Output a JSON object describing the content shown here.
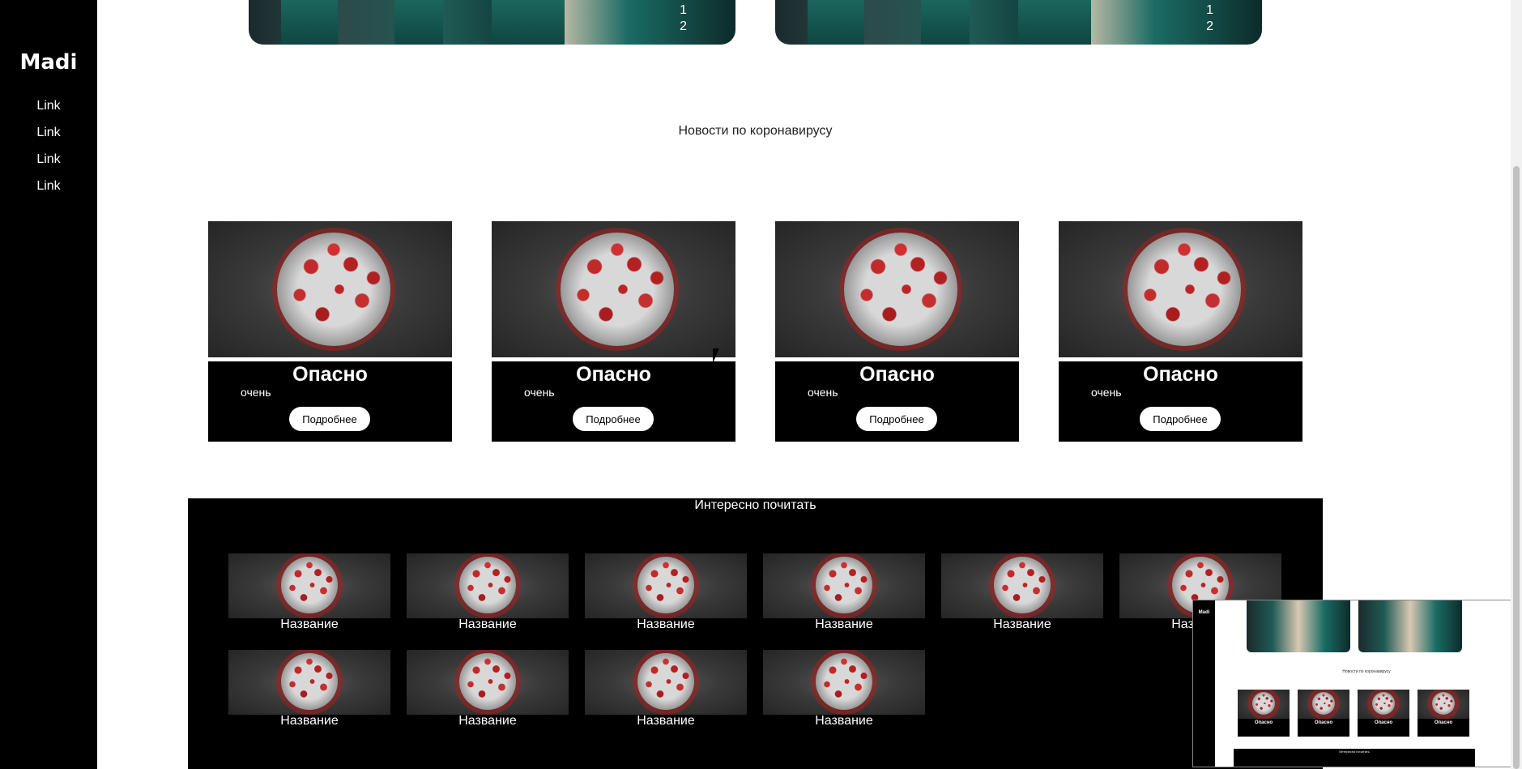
{
  "sidebar": {
    "brand": "Madi",
    "links": [
      "Link",
      "Link",
      "Link",
      "Link"
    ]
  },
  "hero": {
    "slides": [
      {
        "dots": [
          "1",
          "2"
        ]
      },
      {
        "dots": [
          "1",
          "2"
        ]
      }
    ]
  },
  "news": {
    "title": "Новости по коронавирусу",
    "cards": [
      {
        "title": "Опасно",
        "subtitle": "очень",
        "button": "Подробнее"
      },
      {
        "title": "Опасно",
        "subtitle": "очень",
        "button": "Подробнее"
      },
      {
        "title": "Опасно",
        "subtitle": "очень",
        "button": "Подробнее"
      },
      {
        "title": "Опасно",
        "subtitle": "очень",
        "button": "Подробнее"
      }
    ]
  },
  "reading": {
    "title": "Интересно почитать",
    "items": [
      "Название",
      "Название",
      "Название",
      "Название",
      "Название",
      "Название",
      "Название",
      "Название",
      "Название",
      "Название"
    ]
  },
  "preview": {
    "brand": "Madi",
    "news_title": "Новости по коронавирусу",
    "card_title": "Опасно",
    "reading_title": "Интересно почитать"
  }
}
